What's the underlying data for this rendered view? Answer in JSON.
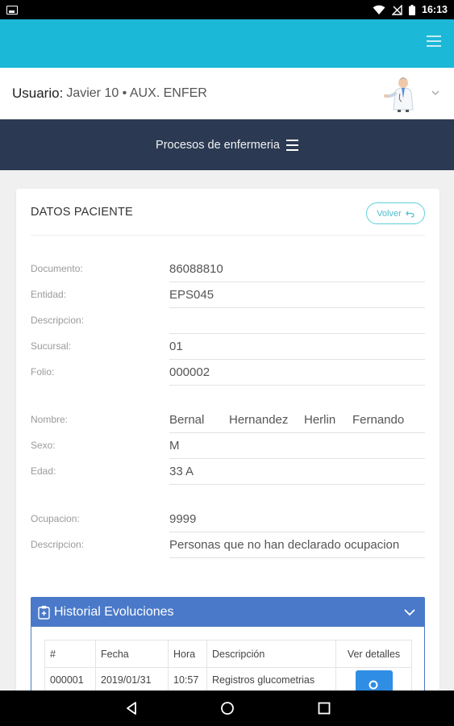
{
  "status_bar": {
    "time": "16:13",
    "icons": [
      "image-icon",
      "wifi-icon",
      "no-signal-icon",
      "battery-icon"
    ]
  },
  "top_bar": {
    "color": "#1cb8d8",
    "menu_icon": "hamburger-icon"
  },
  "user": {
    "label": "Usuario:",
    "value": "Javier 10 • AUX. ENFER",
    "avatar_icon": "doctor-avatar-icon",
    "dropdown_icon": "chevron-down-icon"
  },
  "nav": {
    "title": "Procesos de enfermeria",
    "icon": "hamburger-icon",
    "color": "#2b3a52"
  },
  "card": {
    "title": "DATOS PACIENTE",
    "back_label": "Volver",
    "fields_group1": [
      {
        "label": "Documento:",
        "value": "86088810"
      },
      {
        "label": "Entidad:",
        "value": "EPS045"
      },
      {
        "label": "Descripcion:",
        "value": ""
      },
      {
        "label": "Sucursal:",
        "value": "01"
      },
      {
        "label": "Folio:",
        "value": "000002"
      }
    ],
    "name_field": {
      "label": "Nombre:",
      "parts": [
        "Bernal",
        "Hernandez",
        "Herlin",
        "Fernando"
      ]
    },
    "fields_group2": [
      {
        "label": "Sexo:",
        "value": "M"
      },
      {
        "label": "Edad:",
        "value": "33 A"
      }
    ],
    "fields_group3": [
      {
        "label": "Ocupacion:",
        "value": "9999"
      },
      {
        "label": "Descripcion:",
        "value": "Personas que no han declarado ocupacion"
      }
    ]
  },
  "history": {
    "title": "Historial Evoluciones",
    "color": "#4a79c9",
    "columns": [
      "#",
      "Fecha",
      "Hora",
      "Descripción",
      "Ver detalles"
    ],
    "rows": [
      {
        "num": "000001",
        "fecha": "2019/01/31",
        "hora": "10:57",
        "descripcion": "Registros glucometrias"
      }
    ]
  },
  "bottom_nav": [
    "back-icon",
    "home-icon",
    "recents-icon"
  ]
}
